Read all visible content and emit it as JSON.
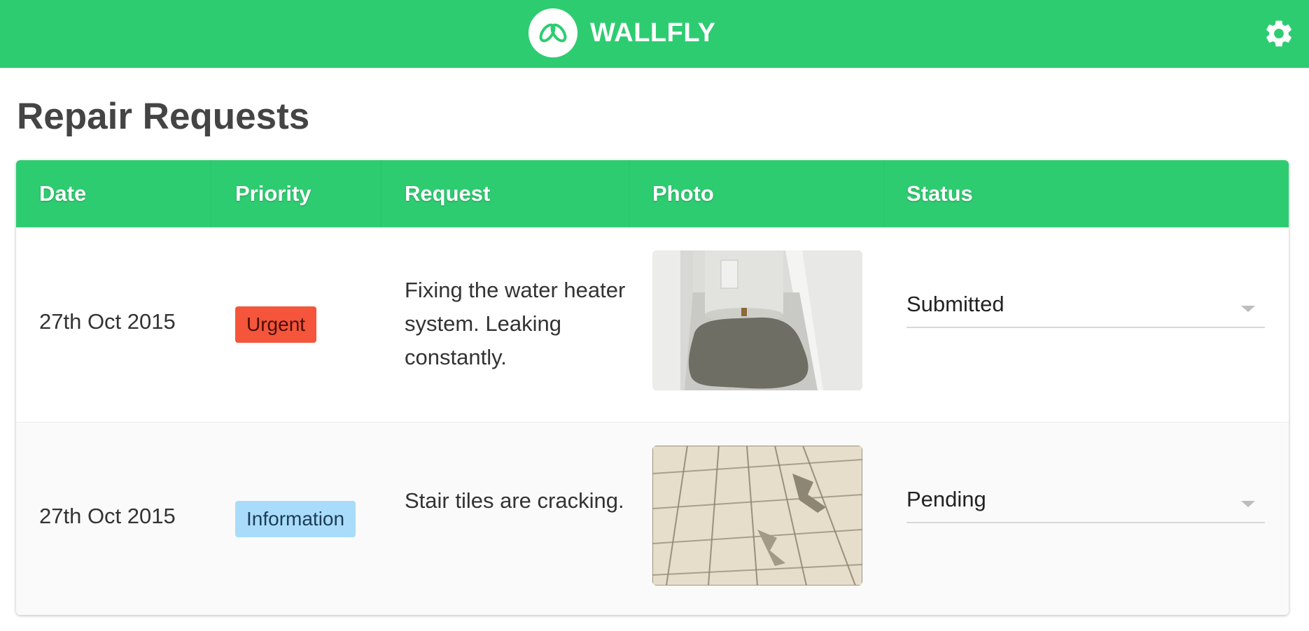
{
  "app": {
    "brand_name": "WALLFLY",
    "logo_icon": "wallfly-logo-icon",
    "settings_icon": "gear-icon",
    "accent_color": "#2ecc71"
  },
  "page": {
    "title": "Repair Requests"
  },
  "table": {
    "columns": [
      "Date",
      "Priority",
      "Request",
      "Photo",
      "Status"
    ],
    "rows": [
      {
        "date": "27th Oct 2015",
        "priority": "Urgent",
        "priority_color": "#f4553b",
        "request": "Fixing the water heater system. Leaking constantly.",
        "photo_icon": "water-heater-photo",
        "status": "Submitted"
      },
      {
        "date": "27th Oct 2015",
        "priority": "Information",
        "priority_color": "#a8dcfa",
        "request": "Stair tiles are cracking.",
        "photo_icon": "cracked-stair-tiles-photo",
        "status": "Pending"
      }
    ]
  }
}
